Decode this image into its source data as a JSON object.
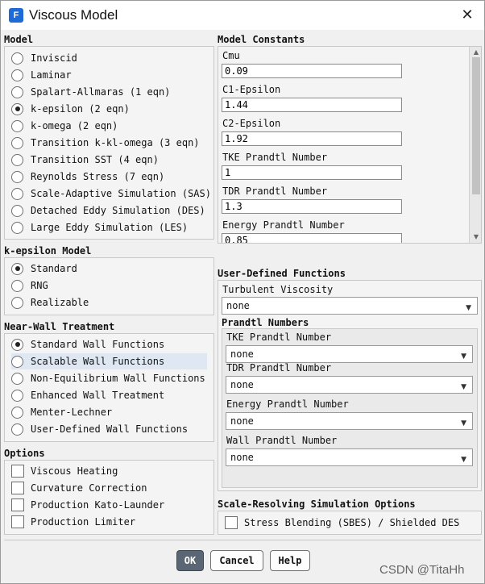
{
  "window": {
    "title": "Viscous Model",
    "app_icon": "F",
    "close_icon": "close-icon"
  },
  "model": {
    "title": "Model",
    "options": [
      {
        "label": "Inviscid",
        "selected": false
      },
      {
        "label": "Laminar",
        "selected": false
      },
      {
        "label": "Spalart-Allmaras (1 eqn)",
        "selected": false
      },
      {
        "label": "k-epsilon (2 eqn)",
        "selected": true
      },
      {
        "label": "k-omega (2 eqn)",
        "selected": false
      },
      {
        "label": "Transition k-kl-omega (3 eqn)",
        "selected": false
      },
      {
        "label": "Transition SST (4 eqn)",
        "selected": false
      },
      {
        "label": "Reynolds Stress (7 eqn)",
        "selected": false
      },
      {
        "label": "Scale-Adaptive Simulation (SAS)",
        "selected": false
      },
      {
        "label": "Detached Eddy Simulation (DES)",
        "selected": false
      },
      {
        "label": "Large Eddy Simulation (LES)",
        "selected": false
      }
    ]
  },
  "ke_model": {
    "title": "k-epsilon Model",
    "options": [
      {
        "label": "Standard",
        "selected": true
      },
      {
        "label": "RNG",
        "selected": false
      },
      {
        "label": "Realizable",
        "selected": false
      }
    ]
  },
  "near_wall": {
    "title": "Near-Wall Treatment",
    "options": [
      {
        "label": "Standard Wall Functions",
        "selected": true
      },
      {
        "label": "Scalable Wall Functions",
        "selected": false,
        "highlighted": true
      },
      {
        "label": "Non-Equilibrium Wall Functions",
        "selected": false
      },
      {
        "label": "Enhanced Wall Treatment",
        "selected": false
      },
      {
        "label": "Menter-Lechner",
        "selected": false
      },
      {
        "label": "User-Defined Wall Functions",
        "selected": false
      }
    ]
  },
  "options": {
    "title": "Options",
    "items": [
      {
        "label": "Viscous Heating",
        "checked": false
      },
      {
        "label": "Curvature Correction",
        "checked": false
      },
      {
        "label": "Production Kato-Launder",
        "checked": false
      },
      {
        "label": "Production Limiter",
        "checked": false
      }
    ]
  },
  "constants": {
    "title": "Model Constants",
    "items": [
      {
        "label": "Cmu",
        "value": "0.09"
      },
      {
        "label": "C1-Epsilon",
        "value": "1.44"
      },
      {
        "label": "C2-Epsilon",
        "value": "1.92"
      },
      {
        "label": "TKE Prandtl Number",
        "value": "1"
      },
      {
        "label": "TDR Prandtl Number",
        "value": "1.3"
      },
      {
        "label": "Energy Prandtl Number",
        "value": "0.85"
      }
    ]
  },
  "udf": {
    "title": "User-Defined Functions",
    "turbulent_viscosity_label": "Turbulent Viscosity",
    "turbulent_viscosity_value": "none",
    "prandtl_title": "Prandtl Numbers",
    "prandtl": [
      {
        "label": "TKE Prandtl Number",
        "value": "none"
      },
      {
        "label": "TDR Prandtl Number",
        "value": "none"
      },
      {
        "label": "Energy Prandtl Number",
        "value": "none"
      },
      {
        "label": "Wall Prandtl Number",
        "value": "none"
      }
    ]
  },
  "srs": {
    "title": "Scale-Resolving Simulation Options",
    "stress_blending_label": "Stress Blending (SBES) / Shielded DES",
    "stress_blending_checked": false
  },
  "buttons": {
    "ok": "OK",
    "cancel": "Cancel",
    "help": "Help"
  },
  "watermark": "CSDN @TitaHh"
}
